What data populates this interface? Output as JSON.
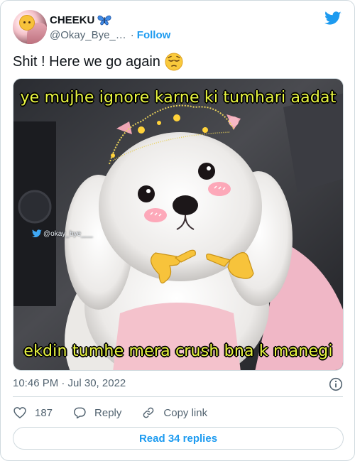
{
  "author": {
    "display_name": "CHEEKU",
    "name_emoji_icon": "butterfly-icon",
    "handle": "@Okay_Bye_…",
    "separator": "·",
    "follow_label": "Follow",
    "avatar_icon": "profile-avatar"
  },
  "tweet": {
    "text": "Shit ! Here we go again",
    "text_emoji_icon": "pensive-face-emoji"
  },
  "media": {
    "caption_top": "ye mujhe ignore karne ki tumhari aadat",
    "caption_bottom": "ekdin tumhe mera crush bna k manegi",
    "watermark": "@okay_bye___",
    "caption_color": "#e8f540"
  },
  "meta": {
    "timestamp": "10:46 PM · Jul 30, 2022"
  },
  "actions": {
    "like_count": "187",
    "reply_label": "Reply",
    "copy_link_label": "Copy link"
  },
  "read_replies_label": "Read 34 replies",
  "colors": {
    "accent": "#1d9bf0",
    "secondary_text": "#536471",
    "border": "#cfd9de"
  }
}
